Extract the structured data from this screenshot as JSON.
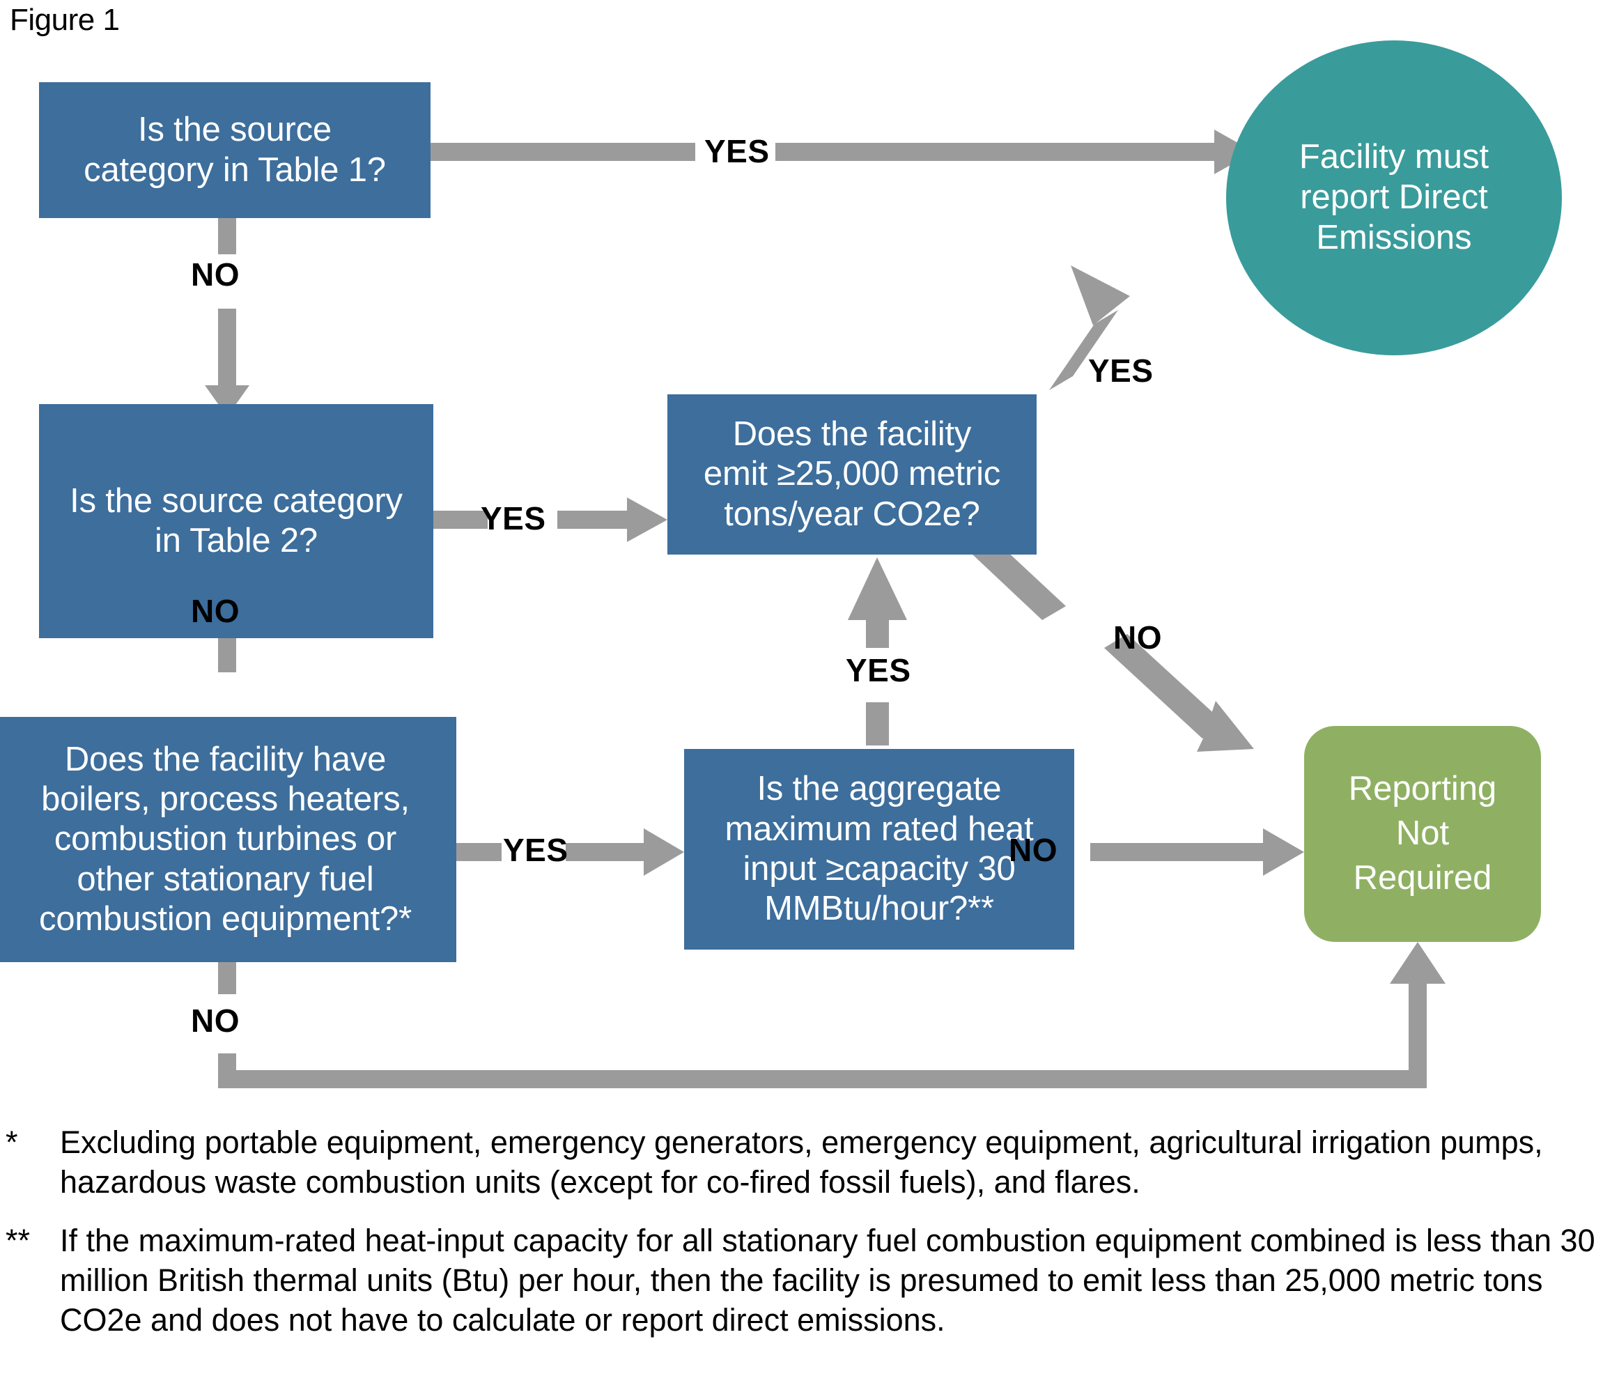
{
  "figure": {
    "title": "Figure 1"
  },
  "colors": {
    "decision_box": "#3d6e9c",
    "terminal_report": "#3a9b9b",
    "terminal_not_required": "#8fb063",
    "connector": "#9b9b9b",
    "text_on_shape": "#ffffff",
    "label_text": "#000000"
  },
  "nodes": {
    "table1": {
      "id": "is-source-category-table-1",
      "text": "Is the source\ncategory in Table 1?",
      "shape": "rectangle"
    },
    "table2": {
      "id": "is-source-category-table-2",
      "text": "Is the source category\nin Table 2?",
      "shape": "rectangle"
    },
    "threshold": {
      "id": "does-facility-emit-threshold",
      "text": "Does the facility\nemit ≥25,000 metric\ntons/year CO2e?",
      "shape": "rectangle"
    },
    "combustion": {
      "id": "does-facility-have-combustion-equipment",
      "text": "Does the facility have\nboilers, process heaters,\ncombustion turbines or\nother stationary fuel\ncombustion equipment?*",
      "shape": "rectangle"
    },
    "heatinput": {
      "id": "is-aggregate-heat-input",
      "text": "Is the aggregate\nmaximum rated heat\ninput ≥capacity 30\nMMBtu/hour?**",
      "shape": "rectangle"
    },
    "must_report": {
      "id": "facility-must-report-direct-emissions",
      "text": "Facility must\nreport Direct\nEmissions",
      "shape": "circle"
    },
    "not_required": {
      "id": "reporting-not-required",
      "text": "Reporting\nNot\nRequired",
      "shape": "rounded-rectangle"
    }
  },
  "edges": [
    {
      "id": "table1-yes",
      "label": "YES",
      "from": "table1",
      "to": "must_report"
    },
    {
      "id": "table1-no",
      "label": "NO",
      "from": "table1",
      "to": "table2"
    },
    {
      "id": "table2-yes",
      "label": "YES",
      "from": "table2",
      "to": "threshold"
    },
    {
      "id": "table2-no",
      "label": "NO",
      "from": "table2",
      "to": "combustion"
    },
    {
      "id": "threshold-yes",
      "label": "YES",
      "from": "threshold",
      "to": "must_report"
    },
    {
      "id": "threshold-no",
      "label": "NO",
      "from": "threshold",
      "to": "not_required"
    },
    {
      "id": "combustion-yes",
      "label": "YES",
      "from": "combustion",
      "to": "heatinput"
    },
    {
      "id": "combustion-no",
      "label": "NO",
      "from": "combustion",
      "to": "not_required"
    },
    {
      "id": "heatinput-yes",
      "label": "YES",
      "from": "heatinput",
      "to": "threshold"
    },
    {
      "id": "heatinput-no",
      "label": "NO",
      "from": "heatinput",
      "to": "not_required"
    }
  ],
  "footnotes": [
    {
      "mark": "*",
      "text": "Excluding portable equipment, emergency generators, emergency equipment, agricultural irrigation pumps, hazardous waste combustion units (except for co-fired fossil fuels), and flares."
    },
    {
      "mark": "**",
      "text": "If the maximum-rated heat-input capacity for all stationary fuel combustion equipment combined is less than 30 million British thermal units (Btu) per hour, then the facility is presumed to emit less than 25,000 metric tons CO2e and does not have to calculate or report direct emissions."
    }
  ]
}
